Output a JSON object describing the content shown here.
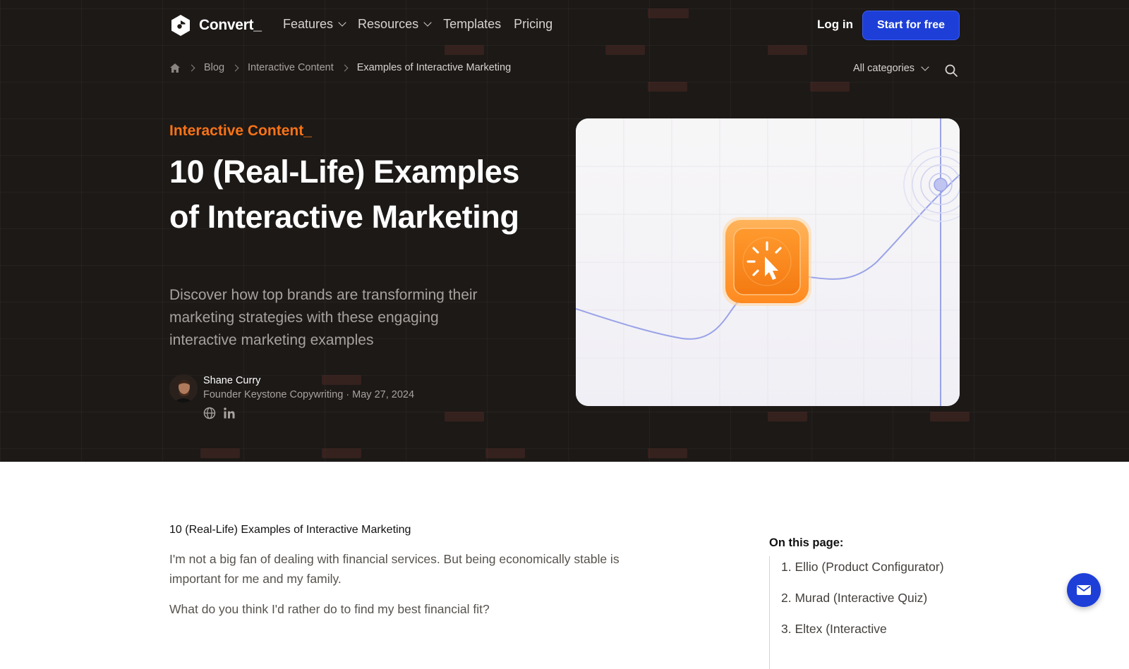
{
  "nav": {
    "logo_text": "Convert_",
    "links": [
      {
        "label": "Features"
      },
      {
        "label": "Resources"
      },
      {
        "label": "Templates"
      },
      {
        "label": "Pricing"
      }
    ],
    "login_label": "Log in",
    "cta_label": "Start for free"
  },
  "breadcrumb": {
    "items": [
      "Blog",
      "Interactive Content"
    ],
    "current": "Examples of Interactive Marketing"
  },
  "filter": {
    "label": "All categories"
  },
  "hero": {
    "kicker": "Interactive Content_",
    "title": "10 (Real-Life) Examples of Interactive Marketing",
    "subtitle": "Discover how top brands are transforming their marketing strategies with these engaging interactive marketing examples"
  },
  "author": {
    "name": "Shane Curry",
    "meta": "Founder Keystone Copywriting · May 27, 2024"
  },
  "article": {
    "heading": "10 (Real-Life) Examples of Interactive Marketing",
    "paragraphs": [
      "I'm not a big fan of dealing with financial services. But being economically stable is important for me and my family.",
      "What do you think I'd rather do to find my best financial fit?"
    ]
  },
  "toc": {
    "title": "On this page:",
    "items": [
      "1. Ellio (Product Configurator)",
      "2. Murad (Interactive Quiz)",
      "3. Eltex (Interactive"
    ]
  },
  "colors": {
    "hero_bg": "#1c1917",
    "accent_orange": "#f97316",
    "primary_blue": "#1d3fd8"
  }
}
